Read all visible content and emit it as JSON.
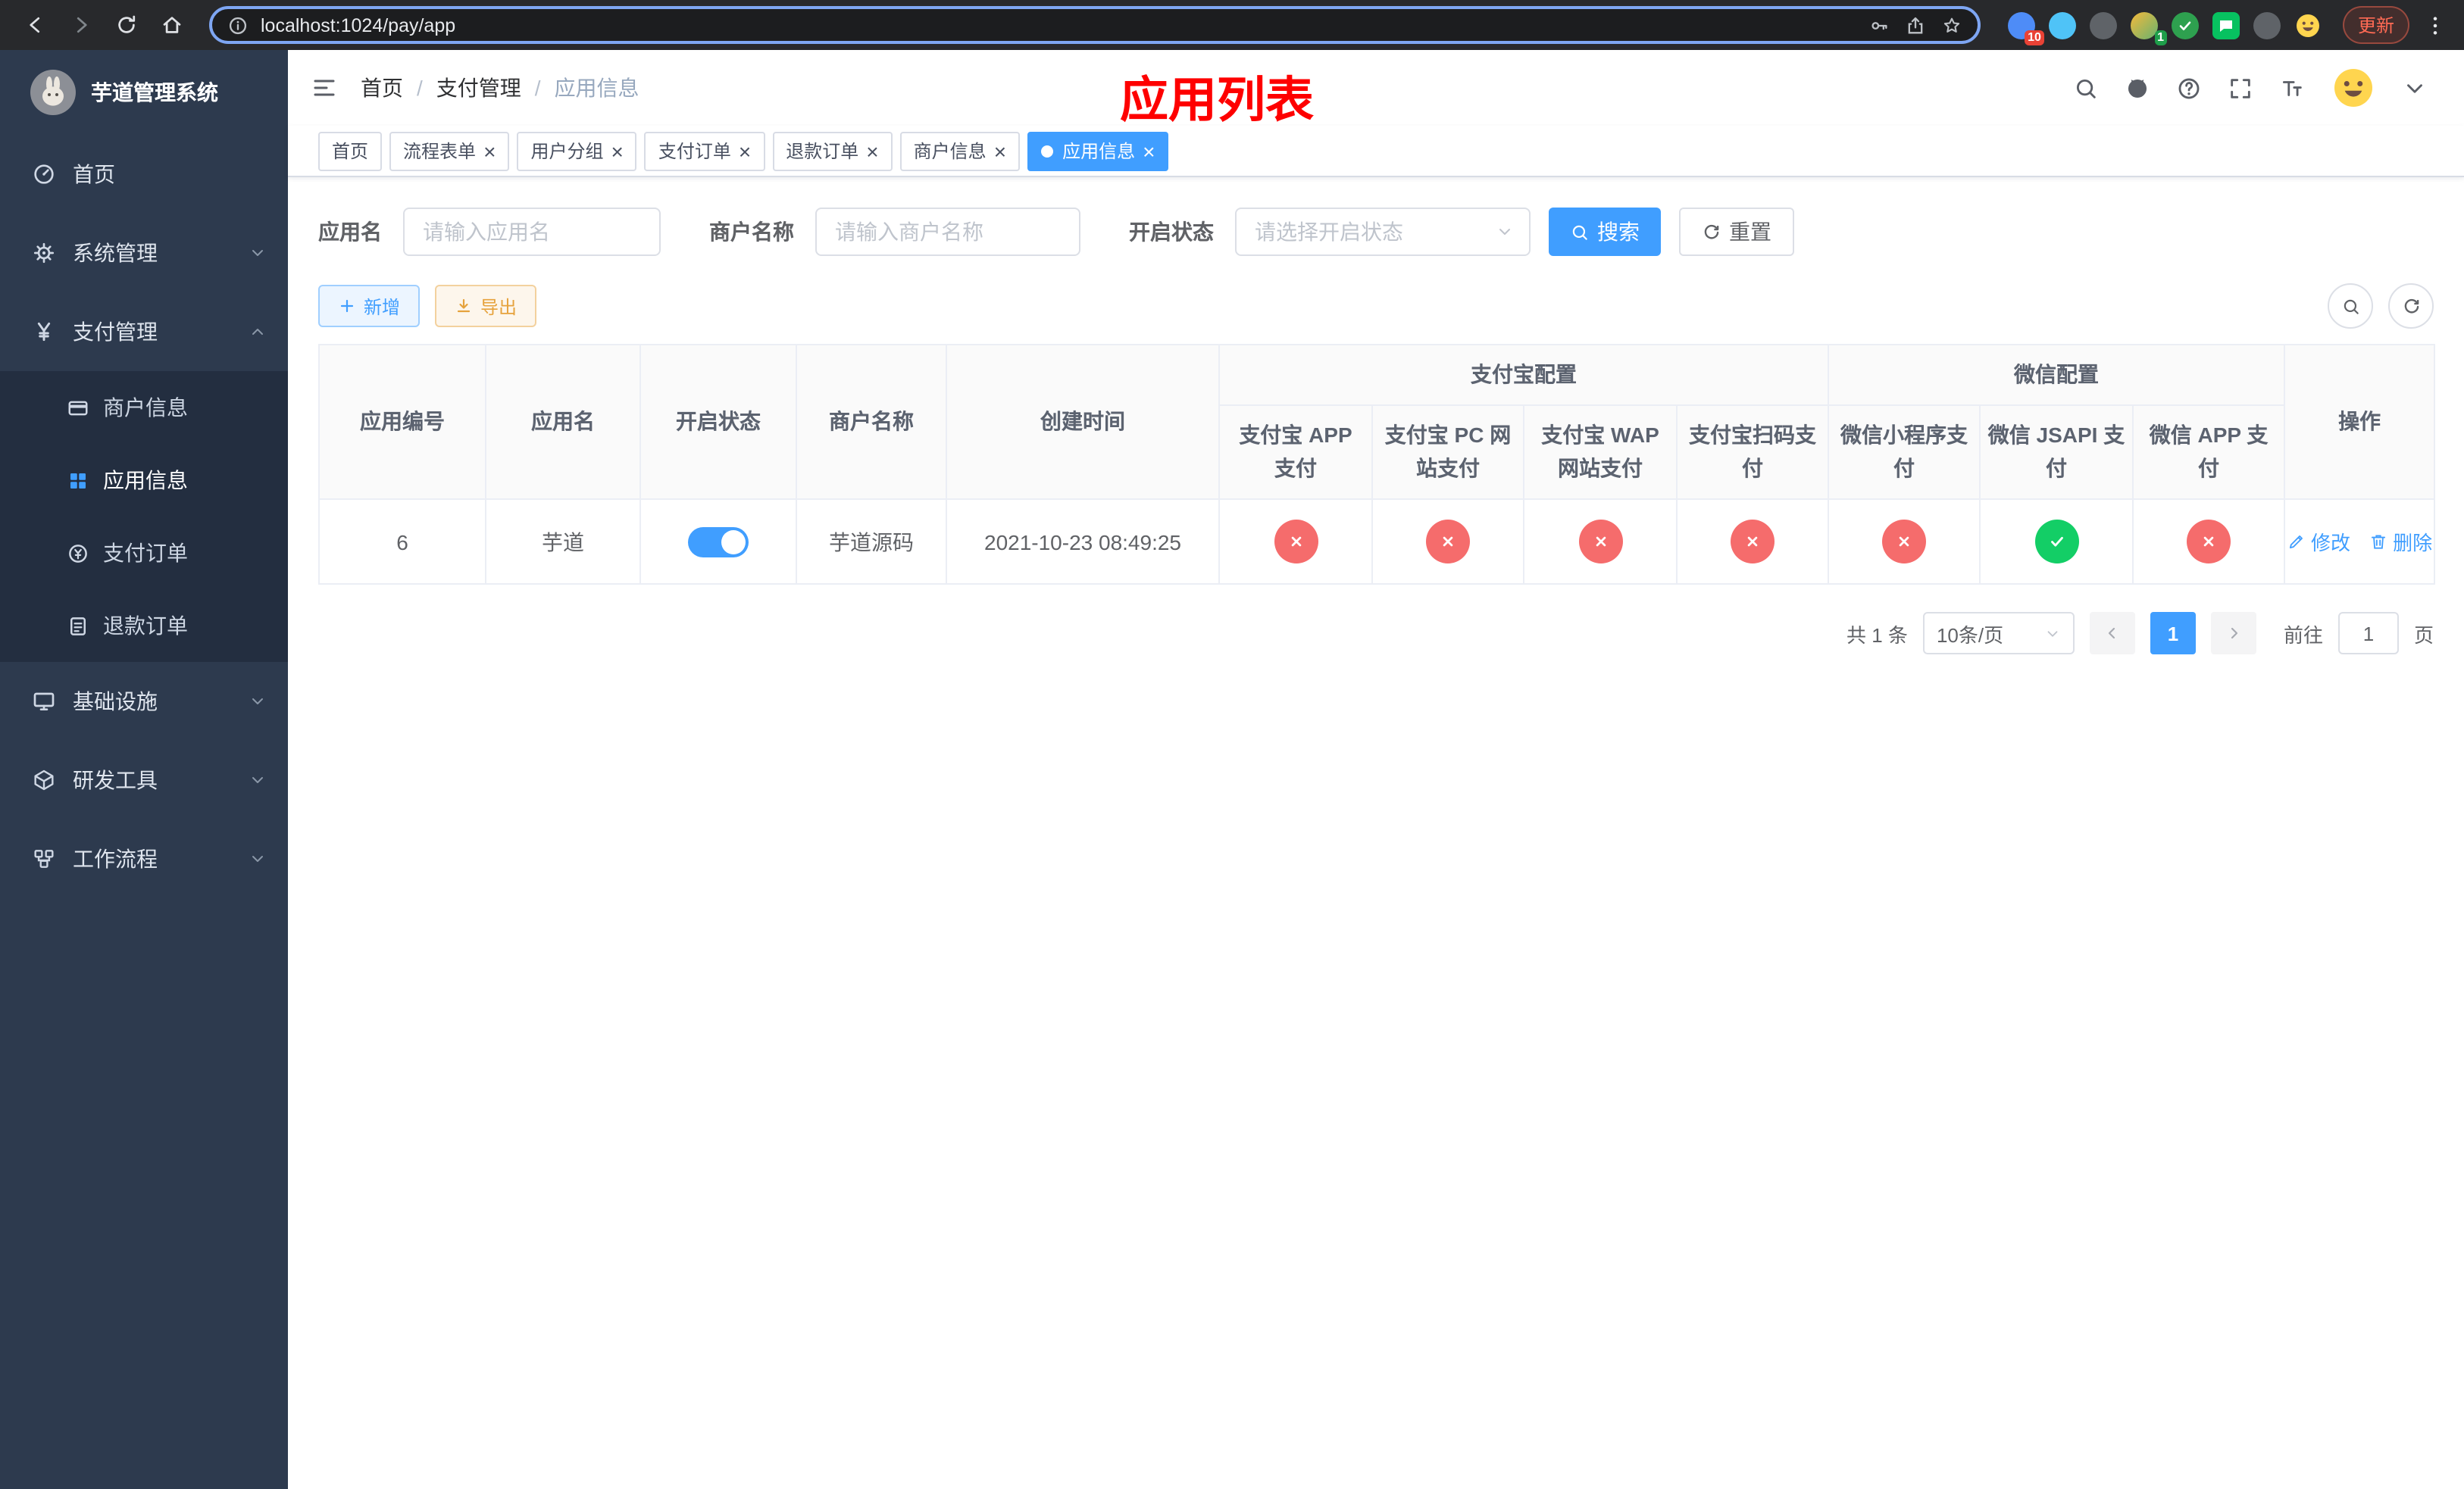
{
  "browser": {
    "url": "localhost:1024/pay/app",
    "update_label": "更新",
    "badge_extensions": "10",
    "badge_avatar": "1"
  },
  "sidebar": {
    "app_title": "芋道管理系统",
    "items": [
      {
        "label": "首页"
      },
      {
        "label": "系统管理"
      },
      {
        "label": "支付管理",
        "expanded": true,
        "children": [
          {
            "label": "商户信息"
          },
          {
            "label": "应用信息",
            "active": true
          },
          {
            "label": "支付订单"
          },
          {
            "label": "退款订单"
          }
        ]
      },
      {
        "label": "基础设施"
      },
      {
        "label": "研发工具"
      },
      {
        "label": "工作流程"
      }
    ]
  },
  "navbar": {
    "breadcrumb": [
      "首页",
      "支付管理",
      "应用信息"
    ],
    "separator": "/"
  },
  "overlay_title": "应用列表",
  "tabs": [
    {
      "label": "首页",
      "closable": false,
      "active": false
    },
    {
      "label": "流程表单",
      "closable": true,
      "active": false
    },
    {
      "label": "用户分组",
      "closable": true,
      "active": false
    },
    {
      "label": "支付订单",
      "closable": true,
      "active": false
    },
    {
      "label": "退款订单",
      "closable": true,
      "active": false
    },
    {
      "label": "商户信息",
      "closable": true,
      "active": false
    },
    {
      "label": "应用信息",
      "closable": true,
      "active": true
    }
  ],
  "filters": {
    "app_name_label": "应用名",
    "app_name_placeholder": "请输入应用名",
    "merchant_label": "商户名称",
    "merchant_placeholder": "请输入商户名称",
    "status_label": "开启状态",
    "status_placeholder": "请选择开启状态",
    "search_label": "搜索",
    "reset_label": "重置"
  },
  "toolbar": {
    "add_label": "新增",
    "export_label": "导出"
  },
  "table": {
    "merged_headers": {
      "alipay": "支付宝配置",
      "wechat": "微信配置"
    },
    "columns": [
      "应用编号",
      "应用名",
      "开启状态",
      "商户名称",
      "创建时间",
      "支付宝 APP 支付",
      "支付宝 PC 网站支付",
      "支付宝 WAP 网站支付",
      "支付宝扫码支付",
      "微信小程序支付",
      "微信 JSAPI 支付",
      "微信 APP 支付",
      "操作"
    ],
    "row": {
      "id": "6",
      "app_name": "芋道",
      "enabled": true,
      "merchant_name": "芋道源码",
      "create_time": "2021-10-23 08:49:25",
      "channel_status": [
        false,
        false,
        false,
        false,
        false,
        true,
        false
      ],
      "actions": {
        "edit": "修改",
        "delete": "删除"
      }
    }
  },
  "pagination": {
    "total": "共 1 条",
    "page_size": "10条/页",
    "page": "1",
    "goto_label": "前往",
    "goto_value": "1",
    "unit_label": "页"
  },
  "colors": {
    "primary": "#409eff",
    "success": "#13ce66",
    "danger": "#f56c6c",
    "warning": "#e6a23c",
    "sidebar_bg": "#2d3a4e",
    "overlay_title": "#fe0000"
  }
}
